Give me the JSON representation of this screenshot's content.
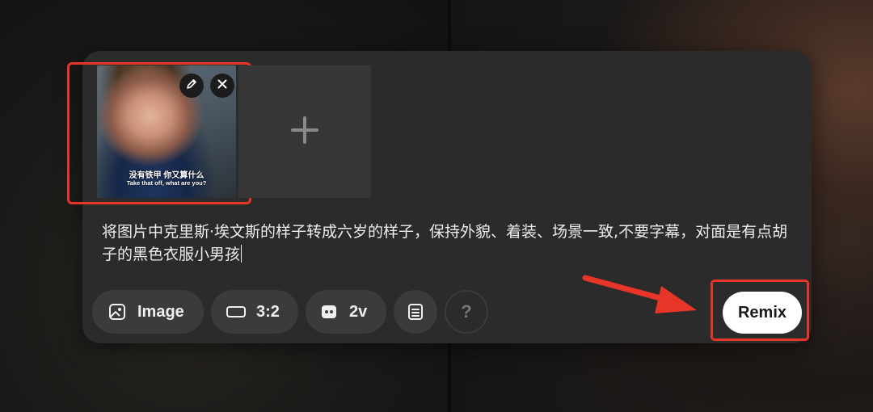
{
  "thumbnail": {
    "subtitle_cn": "没有铁甲  你又算什么",
    "subtitle_en": "Take that off, what are you?",
    "edit_icon": "pencil-icon",
    "remove_icon": "close-icon"
  },
  "add_slot": {
    "icon": "plus-icon"
  },
  "prompt": {
    "text": "将图片中克里斯·埃文斯的样子转成六岁的样子，保持外貌、着装、场景一致,不要字幕，对面是有点胡子的黑色衣服小男孩"
  },
  "toolbar": {
    "image_label": "Image",
    "ratio_label": "3:2",
    "duration_label": "2v",
    "help_label": "?",
    "remix_label": "Remix"
  },
  "annotations": {
    "highlight_color": "#e8352a"
  }
}
